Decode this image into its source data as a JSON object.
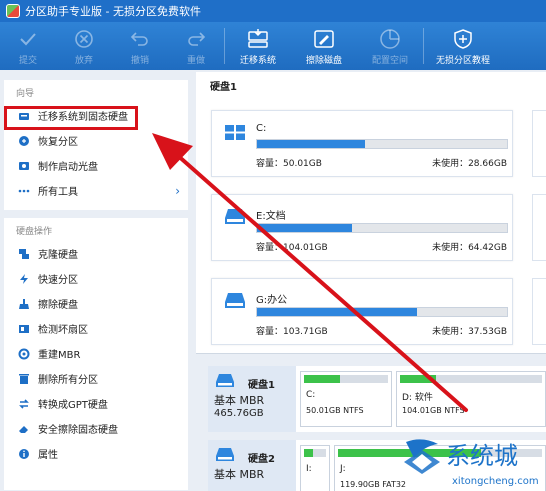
{
  "window": {
    "title": "分区助手专业版 - 无损分区免费软件"
  },
  "toolbar": {
    "items": [
      {
        "label": "提交",
        "icon": "check-icon",
        "enabled": false
      },
      {
        "label": "放弃",
        "icon": "cancel-circle-icon",
        "enabled": false
      },
      {
        "label": "撤销",
        "icon": "undo-icon",
        "enabled": false
      },
      {
        "label": "重做",
        "icon": "redo-icon",
        "enabled": false
      },
      {
        "label": "迁移系统",
        "icon": "migrate-os-icon",
        "enabled": true
      },
      {
        "label": "擦除磁盘",
        "icon": "wipe-disk-icon",
        "enabled": true
      },
      {
        "label": "配置空间",
        "icon": "allocate-space-icon",
        "enabled": false
      },
      {
        "label": "无损分区教程",
        "icon": "shield-icon",
        "enabled": true
      }
    ]
  },
  "sidebar": {
    "wizard_header": "向导",
    "wizard_items": [
      {
        "label": "迁移系统到固态硬盘",
        "icon": "migrate-ssd-icon"
      },
      {
        "label": "恢复分区",
        "icon": "recover-partition-icon"
      },
      {
        "label": "制作启动光盘",
        "icon": "boot-disc-icon"
      },
      {
        "label": "所有工具",
        "icon": "more-dots-icon"
      }
    ],
    "disk_ops_header": "硬盘操作",
    "disk_ops_items": [
      {
        "label": "克隆硬盘",
        "icon": "clone-disk-icon"
      },
      {
        "label": "快速分区",
        "icon": "quick-partition-icon"
      },
      {
        "label": "擦除硬盘",
        "icon": "wipe-icon"
      },
      {
        "label": "检测坏扇区",
        "icon": "bad-sector-icon"
      },
      {
        "label": "重建MBR",
        "icon": "rebuild-mbr-icon"
      },
      {
        "label": "删除所有分区",
        "icon": "delete-partitions-icon"
      },
      {
        "label": "转换成GPT硬盘",
        "icon": "convert-gpt-icon"
      },
      {
        "label": "安全擦除固态硬盘",
        "icon": "secure-erase-icon"
      },
      {
        "label": "属性",
        "icon": "properties-icon"
      }
    ]
  },
  "main": {
    "disk_title": "硬盘1",
    "partitions": [
      {
        "name": "C:",
        "capacity_label": "容量：50.01GB",
        "free_label": "未使用：28.66GB",
        "used_fraction": 0.43,
        "icon": "windows-drive-icon"
      },
      {
        "name": "E:文档",
        "capacity_label": "容量：104.01GB",
        "free_label": "未使用：64.42GB",
        "used_fraction": 0.38,
        "icon": "drive-icon"
      },
      {
        "name": "G:办公",
        "capacity_label": "容量：103.71GB",
        "free_label": "未使用：37.53GB",
        "used_fraction": 0.64,
        "icon": "drive-icon"
      }
    ]
  },
  "disk_map": {
    "disks": [
      {
        "name": "硬盘1",
        "type": "基本 MBR",
        "size": "465.76GB",
        "segments": [
          {
            "label": "C:",
            "desc": "50.01GB NTFS",
            "used_fraction": 0.43
          },
          {
            "label": "D: 软件",
            "desc": "104.01GB NTFS",
            "used_fraction": 0.25
          }
        ]
      },
      {
        "name": "硬盘2",
        "type": "基本 MBR",
        "size": "",
        "segments": [
          {
            "label": "I:",
            "desc": "",
            "used_fraction": 0.4
          },
          {
            "label": "J:",
            "desc": "119.90GB FAT32",
            "used_fraction": 0.7
          }
        ]
      }
    ]
  },
  "watermark": {
    "text": "系统城",
    "sub": "xitongcheng.com"
  },
  "colors": {
    "accent": "#1f6fc8",
    "bar_fill": "#2e86de",
    "map_green": "#3cc24a",
    "annotation_red": "#d8121a"
  }
}
